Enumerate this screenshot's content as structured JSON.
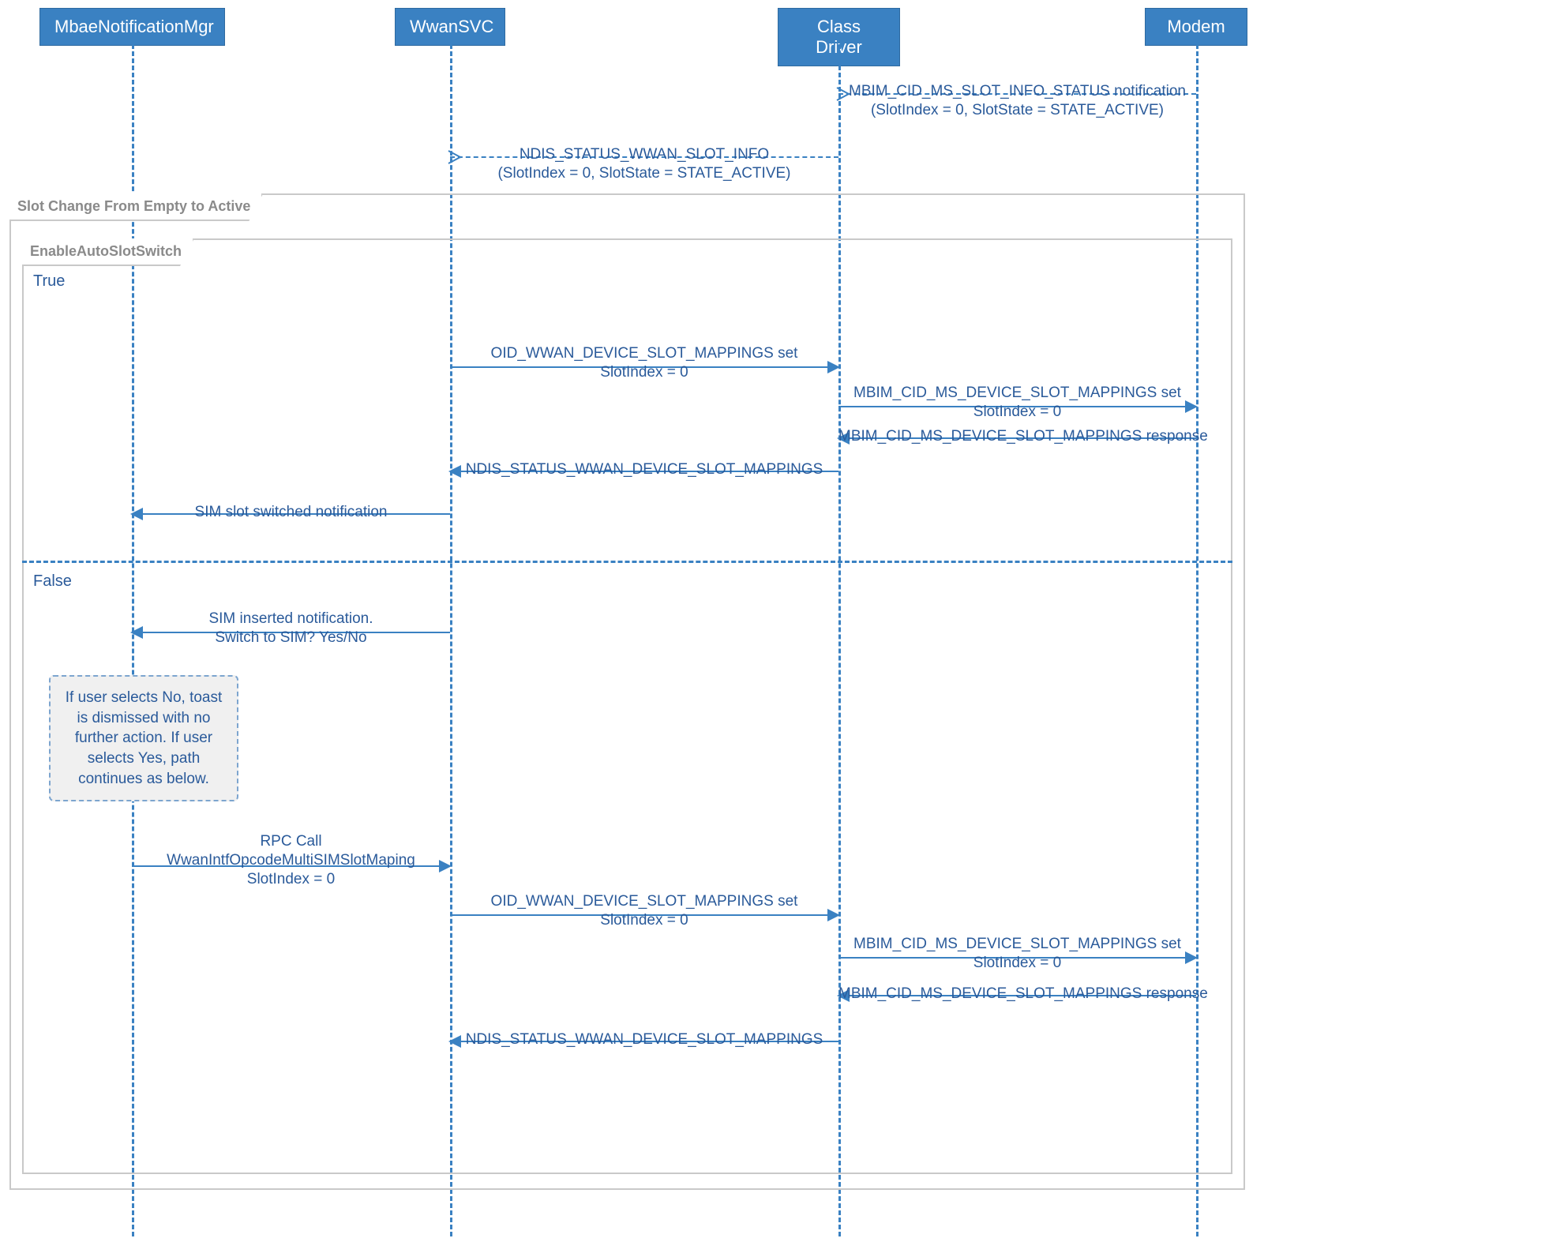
{
  "actors": {
    "mbae": "MbaeNotificationMgr",
    "wwansvc": "WwanSVC",
    "classdriver": "Class Driver",
    "modem": "Modem"
  },
  "frames": {
    "outer": "Slot Change From Empty to Active",
    "inner": "EnableAutoSlotSwitch"
  },
  "guards": {
    "true": "True",
    "false": "False"
  },
  "messages": {
    "m1": "MBIM_CID_MS_SLOT_INFO_STATUS notification\n(SlotIndex = 0, SlotState = STATE_ACTIVE)",
    "m2": "NDIS_STATUS_WWAN_SLOT_INFO\n(SlotIndex = 0, SlotState = STATE_ACTIVE)",
    "m3": "OID_WWAN_DEVICE_SLOT_MAPPINGS set\nSlotIndex = 0",
    "m4": "MBIM_CID_MS_DEVICE_SLOT_MAPPINGS set\nSlotIndex = 0",
    "m5": "MBIM_CID_MS_DEVICE_SLOT_MAPPINGS response",
    "m6": "NDIS_STATUS_WWAN_DEVICE_SLOT_MAPPINGS",
    "m7": "SIM slot switched notification",
    "m8": "SIM inserted notification.\nSwitch to SIM? Yes/No",
    "m9": "RPC Call\nWwanIntfOpcodeMultiSIMSlotMaping\nSlotIndex = 0",
    "m10": "OID_WWAN_DEVICE_SLOT_MAPPINGS set\nSlotIndex = 0",
    "m11": "MBIM_CID_MS_DEVICE_SLOT_MAPPINGS set\nSlotIndex = 0",
    "m12": "MBIM_CID_MS_DEVICE_SLOT_MAPPINGS response",
    "m13": "NDIS_STATUS_WWAN_DEVICE_SLOT_MAPPINGS"
  },
  "note": "If user selects No, toast\nis dismissed with no\nfurther action. If user\nselects Yes, path\ncontinues as below.",
  "chart_data": {
    "type": "sequence-diagram",
    "actors": [
      "MbaeNotificationMgr",
      "WwanSVC",
      "Class Driver",
      "Modem"
    ],
    "messages": [
      {
        "from": "Modem",
        "to": "Class Driver",
        "label": "MBIM_CID_MS_SLOT_INFO_STATUS notification (SlotIndex = 0, SlotState = STATE_ACTIVE)",
        "style": "dashed"
      },
      {
        "from": "Class Driver",
        "to": "WwanSVC",
        "label": "NDIS_STATUS_WWAN_SLOT_INFO (SlotIndex = 0, SlotState = STATE_ACTIVE)",
        "style": "dashed"
      },
      {
        "fragment": "Slot Change From Empty to Active",
        "type": "frame",
        "children": [
          {
            "fragment": "EnableAutoSlotSwitch",
            "type": "alt",
            "regions": [
              {
                "guard": "True",
                "messages": [
                  {
                    "from": "WwanSVC",
                    "to": "Class Driver",
                    "label": "OID_WWAN_DEVICE_SLOT_MAPPINGS set SlotIndex = 0"
                  },
                  {
                    "from": "Class Driver",
                    "to": "Modem",
                    "label": "MBIM_CID_MS_DEVICE_SLOT_MAPPINGS set SlotIndex = 0"
                  },
                  {
                    "from": "Modem",
                    "to": "Class Driver",
                    "label": "MBIM_CID_MS_DEVICE_SLOT_MAPPINGS response"
                  },
                  {
                    "from": "Class Driver",
                    "to": "WwanSVC",
                    "label": "NDIS_STATUS_WWAN_DEVICE_SLOT_MAPPINGS"
                  },
                  {
                    "from": "WwanSVC",
                    "to": "MbaeNotificationMgr",
                    "label": "SIM slot switched notification"
                  }
                ]
              },
              {
                "guard": "False",
                "messages": [
                  {
                    "from": "WwanSVC",
                    "to": "MbaeNotificationMgr",
                    "label": "SIM inserted notification. Switch to SIM? Yes/No"
                  },
                  {
                    "note": "If user selects No, toast is dismissed with no further action. If user selects Yes, path continues as below.",
                    "attached_to": "MbaeNotificationMgr"
                  },
                  {
                    "from": "MbaeNotificationMgr",
                    "to": "WwanSVC",
                    "label": "RPC Call WwanIntfOpcodeMultiSIMSlotMaping SlotIndex = 0"
                  },
                  {
                    "from": "WwanSVC",
                    "to": "Class Driver",
                    "label": "OID_WWAN_DEVICE_SLOT_MAPPINGS set SlotIndex = 0"
                  },
                  {
                    "from": "Class Driver",
                    "to": "Modem",
                    "label": "MBIM_CID_MS_DEVICE_SLOT_MAPPINGS set SlotIndex = 0"
                  },
                  {
                    "from": "Modem",
                    "to": "Class Driver",
                    "label": "MBIM_CID_MS_DEVICE_SLOT_MAPPINGS response"
                  },
                  {
                    "from": "Class Driver",
                    "to": "WwanSVC",
                    "label": "NDIS_STATUS_WWAN_DEVICE_SLOT_MAPPINGS"
                  }
                ]
              }
            ]
          }
        ]
      }
    ]
  }
}
